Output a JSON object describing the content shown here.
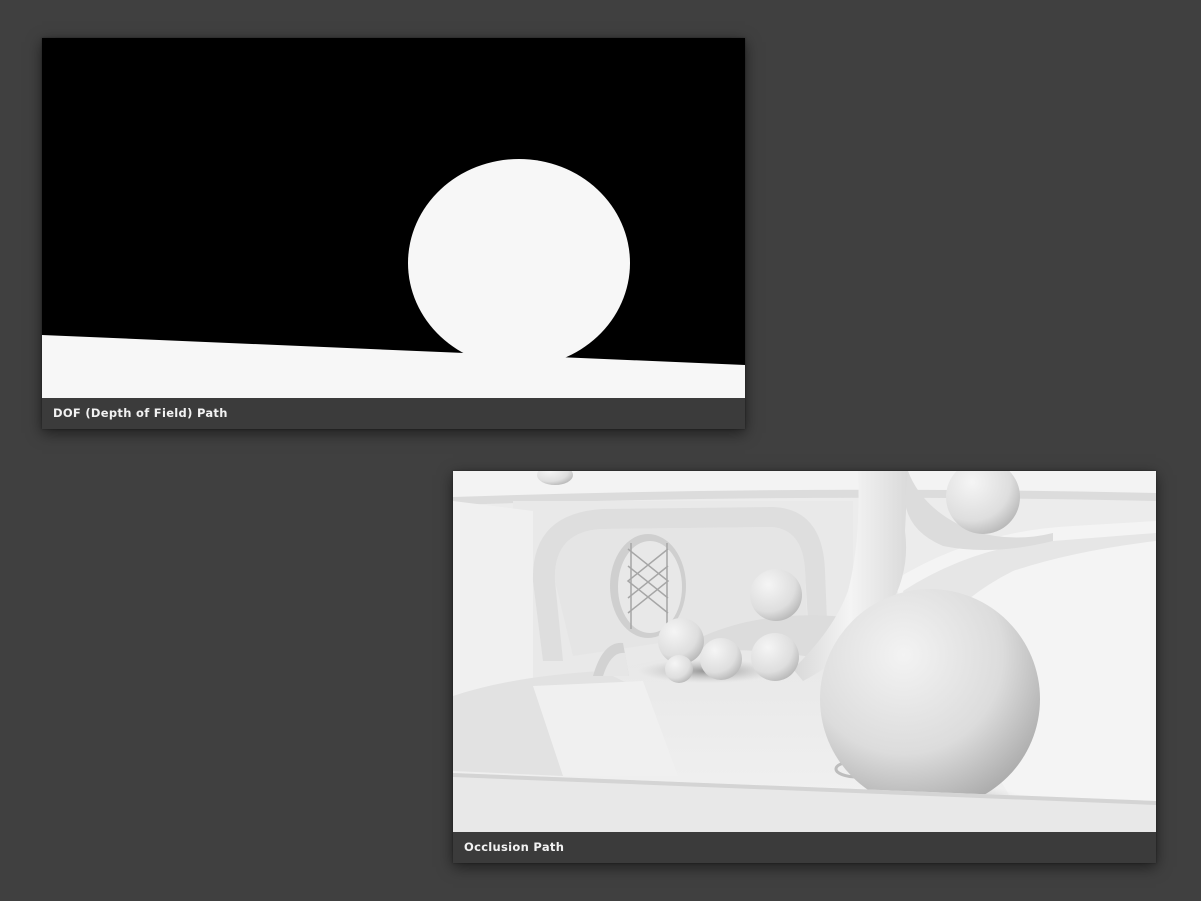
{
  "background_color": "#404040",
  "panels": [
    {
      "id": "dof",
      "caption": "DOF (Depth of Field) Path",
      "content": "depth-of-field-render"
    },
    {
      "id": "occlusion",
      "caption": "Occlusion Path",
      "content": "ambient-occlusion-render"
    }
  ]
}
